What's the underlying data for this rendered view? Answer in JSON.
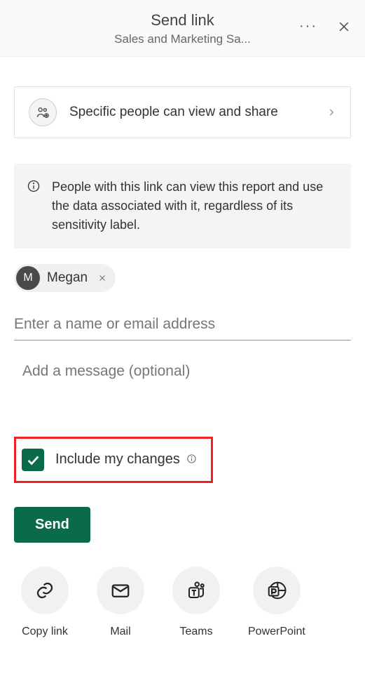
{
  "header": {
    "title": "Send link",
    "subtitle": "Sales and Marketing Sa..."
  },
  "permission": {
    "label": "Specific people can view and share"
  },
  "info": {
    "text": "People with this link can view this report and use the data associated with it, regardless of its sensitivity label."
  },
  "recipients": [
    {
      "initial": "M",
      "name": "Megan"
    }
  ],
  "name_input": {
    "placeholder": "Enter a name or email address",
    "value": ""
  },
  "message_input": {
    "placeholder": "Add a message (optional)",
    "value": ""
  },
  "include_changes": {
    "label": "Include my changes",
    "checked": true
  },
  "send_button": {
    "label": "Send"
  },
  "share_options": [
    {
      "id": "copy-link",
      "label": "Copy link"
    },
    {
      "id": "mail",
      "label": "Mail"
    },
    {
      "id": "teams",
      "label": "Teams"
    },
    {
      "id": "powerpoint",
      "label": "PowerPoint"
    }
  ]
}
